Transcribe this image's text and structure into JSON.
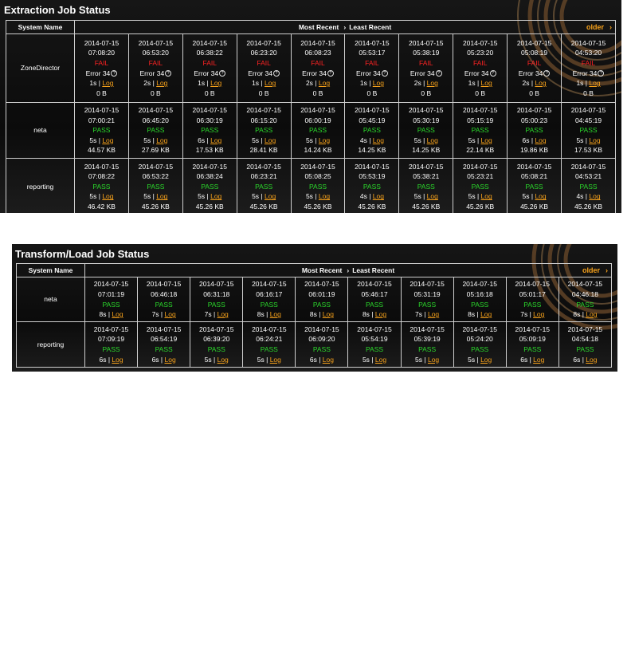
{
  "extraction": {
    "title": "Extraction Job Status",
    "header": {
      "system_name": "System Name",
      "most_recent": "Most Recent",
      "separator": "›",
      "least_recent": "Least Recent",
      "older": "older",
      "older_chevron": "›"
    },
    "rows": [
      {
        "system": "ZoneDirector",
        "kind": "error",
        "runs": [
          {
            "date": "2014-07-15",
            "time": "07:08:20",
            "status": "FAIL",
            "error": "Error 34",
            "duration": "1s",
            "log": "Log",
            "size": "0 B"
          },
          {
            "date": "2014-07-15",
            "time": "06:53:20",
            "status": "FAIL",
            "error": "Error 34",
            "duration": "2s",
            "log": "Log",
            "size": "0 B"
          },
          {
            "date": "2014-07-15",
            "time": "06:38:22",
            "status": "FAIL",
            "error": "Error 34",
            "duration": "1s",
            "log": "Log",
            "size": "0 B"
          },
          {
            "date": "2014-07-15",
            "time": "06:23:20",
            "status": "FAIL",
            "error": "Error 34",
            "duration": "1s",
            "log": "Log",
            "size": "0 B"
          },
          {
            "date": "2014-07-15",
            "time": "06:08:23",
            "status": "FAIL",
            "error": "Error 34",
            "duration": "2s",
            "log": "Log",
            "size": "0 B"
          },
          {
            "date": "2014-07-15",
            "time": "05:53:17",
            "status": "FAIL",
            "error": "Error 34",
            "duration": "1s",
            "log": "Log",
            "size": "0 B"
          },
          {
            "date": "2014-07-15",
            "time": "05:38:19",
            "status": "FAIL",
            "error": "Error 34",
            "duration": "2s",
            "log": "Log",
            "size": "0 B"
          },
          {
            "date": "2014-07-15",
            "time": "05:23:20",
            "status": "FAIL",
            "error": "Error 34",
            "duration": "1s",
            "log": "Log",
            "size": "0 B"
          },
          {
            "date": "2014-07-15",
            "time": "05:08:19",
            "status": "FAIL",
            "error": "Error 34",
            "duration": "2s",
            "log": "Log",
            "size": "0 B"
          },
          {
            "date": "2014-07-15",
            "time": "04:53:20",
            "status": "FAIL",
            "error": "Error 34",
            "duration": "1s",
            "log": "Log",
            "size": "0 B"
          }
        ]
      },
      {
        "system": "neta",
        "kind": "pass",
        "runs": [
          {
            "date": "2014-07-15",
            "time": "07:00:21",
            "status": "PASS",
            "duration": "5s",
            "log": "Log",
            "size": "44.57 KB"
          },
          {
            "date": "2014-07-15",
            "time": "06:45:20",
            "status": "PASS",
            "duration": "5s",
            "log": "Log",
            "size": "27.69 KB"
          },
          {
            "date": "2014-07-15",
            "time": "06:30:19",
            "status": "PASS",
            "duration": "6s",
            "log": "Log",
            "size": "17.53 KB"
          },
          {
            "date": "2014-07-15",
            "time": "06:15:20",
            "status": "PASS",
            "duration": "5s",
            "log": "Log",
            "size": "28.41 KB"
          },
          {
            "date": "2014-07-15",
            "time": "06:00:19",
            "status": "PASS",
            "duration": "5s",
            "log": "Log",
            "size": "14.24 KB"
          },
          {
            "date": "2014-07-15",
            "time": "05:45:19",
            "status": "PASS",
            "duration": "4s",
            "log": "Log",
            "size": "14.25 KB"
          },
          {
            "date": "2014-07-15",
            "time": "05:30:19",
            "status": "PASS",
            "duration": "5s",
            "log": "Log",
            "size": "14.25 KB"
          },
          {
            "date": "2014-07-15",
            "time": "05:15:19",
            "status": "PASS",
            "duration": "5s",
            "log": "Log",
            "size": "22.14 KB"
          },
          {
            "date": "2014-07-15",
            "time": "05:00:23",
            "status": "PASS",
            "duration": "6s",
            "log": "Log",
            "size": "19.86 KB"
          },
          {
            "date": "2014-07-15",
            "time": "04:45:19",
            "status": "PASS",
            "duration": "5s",
            "log": "Log",
            "size": "17.53 KB"
          }
        ]
      },
      {
        "system": "reporting",
        "kind": "pass",
        "runs": [
          {
            "date": "2014-07-15",
            "time": "07:08:22",
            "status": "PASS",
            "duration": "5s",
            "log": "Log",
            "size": "46.42 KB"
          },
          {
            "date": "2014-07-15",
            "time": "06:53:22",
            "status": "PASS",
            "duration": "5s",
            "log": "Log",
            "size": "45.26 KB"
          },
          {
            "date": "2014-07-15",
            "time": "06:38:24",
            "status": "PASS",
            "duration": "5s",
            "log": "Log",
            "size": "45.26 KB"
          },
          {
            "date": "2014-07-15",
            "time": "06:23:21",
            "status": "PASS",
            "duration": "5s",
            "log": "Log",
            "size": "45.26 KB"
          },
          {
            "date": "2014-07-15",
            "time": "05:08:25",
            "status": "PASS",
            "duration": "5s",
            "log": "Log",
            "size": "45.26 KB"
          },
          {
            "date": "2014-07-15",
            "time": "05:53:19",
            "status": "PASS",
            "duration": "4s",
            "log": "Log",
            "size": "45.26 KB"
          },
          {
            "date": "2014-07-15",
            "time": "05:38:21",
            "status": "PASS",
            "duration": "5s",
            "log": "Log",
            "size": "45.26 KB"
          },
          {
            "date": "2014-07-15",
            "time": "05:23:21",
            "status": "PASS",
            "duration": "5s",
            "log": "Log",
            "size": "45.26 KB"
          },
          {
            "date": "2014-07-15",
            "time": "05:08:21",
            "status": "PASS",
            "duration": "5s",
            "log": "Log",
            "size": "45.26 KB"
          },
          {
            "date": "2014-07-15",
            "time": "04:53:21",
            "status": "PASS",
            "duration": "4s",
            "log": "Log",
            "size": "45.26 KB"
          }
        ]
      }
    ]
  },
  "transform": {
    "title": "Transform/Load Job Status",
    "header": {
      "system_name": "System Name",
      "most_recent": "Most Recent",
      "separator": "›",
      "least_recent": "Least Recent",
      "older": "older",
      "older_chevron": "›"
    },
    "rows": [
      {
        "system": "neta",
        "kind": "pass",
        "runs": [
          {
            "date": "2014-07-15",
            "time": "07:01:19",
            "status": "PASS",
            "duration": "8s",
            "log": "Log"
          },
          {
            "date": "2014-07-15",
            "time": "06:46:18",
            "status": "PASS",
            "duration": "7s",
            "log": "Log"
          },
          {
            "date": "2014-07-15",
            "time": "06:31:18",
            "status": "PASS",
            "duration": "7s",
            "log": "Log"
          },
          {
            "date": "2014-07-15",
            "time": "06:16:17",
            "status": "PASS",
            "duration": "8s",
            "log": "Log"
          },
          {
            "date": "2014-07-15",
            "time": "06:01:19",
            "status": "PASS",
            "duration": "8s",
            "log": "Log"
          },
          {
            "date": "2014-07-15",
            "time": "05:46:17",
            "status": "PASS",
            "duration": "8s",
            "log": "Log"
          },
          {
            "date": "2014-07-15",
            "time": "05:31:19",
            "status": "PASS",
            "duration": "7s",
            "log": "Log"
          },
          {
            "date": "2014-07-15",
            "time": "05:16:18",
            "status": "PASS",
            "duration": "8s",
            "log": "Log"
          },
          {
            "date": "2014-07-15",
            "time": "05:01:17",
            "status": "PASS",
            "duration": "7s",
            "log": "Log"
          },
          {
            "date": "2014-07-15",
            "time": "04:46:18",
            "status": "PASS",
            "duration": "8s",
            "log": "Log"
          }
        ]
      },
      {
        "system": "reporting",
        "kind": "pass",
        "runs": [
          {
            "date": "2014-07-15",
            "time": "07:09:19",
            "status": "PASS",
            "duration": "6s",
            "log": "Log"
          },
          {
            "date": "2014-07-15",
            "time": "06:54:19",
            "status": "PASS",
            "duration": "6s",
            "log": "Log"
          },
          {
            "date": "2014-07-15",
            "time": "06:39:20",
            "status": "PASS",
            "duration": "5s",
            "log": "Log"
          },
          {
            "date": "2014-07-15",
            "time": "06:24:21",
            "status": "PASS",
            "duration": "5s",
            "log": "Log"
          },
          {
            "date": "2014-07-15",
            "time": "06:09:20",
            "status": "PASS",
            "duration": "6s",
            "log": "Log"
          },
          {
            "date": "2014-07-15",
            "time": "05:54:19",
            "status": "PASS",
            "duration": "5s",
            "log": "Log"
          },
          {
            "date": "2014-07-15",
            "time": "05:39:19",
            "status": "PASS",
            "duration": "5s",
            "log": "Log"
          },
          {
            "date": "2014-07-15",
            "time": "05:24:20",
            "status": "PASS",
            "duration": "5s",
            "log": "Log"
          },
          {
            "date": "2014-07-15",
            "time": "05:09:19",
            "status": "PASS",
            "duration": "6s",
            "log": "Log"
          },
          {
            "date": "2014-07-15",
            "time": "04:54:18",
            "status": "PASS",
            "duration": "6s",
            "log": "Log"
          }
        ]
      }
    ]
  },
  "colors": {
    "pass": "#2bd82b",
    "fail": "#ff2222",
    "link": "#f7a21b",
    "panel_bg": "#111111"
  },
  "icons": {
    "error_help": "question-circle-icon",
    "older_chevron": "chevron-right-icon"
  }
}
